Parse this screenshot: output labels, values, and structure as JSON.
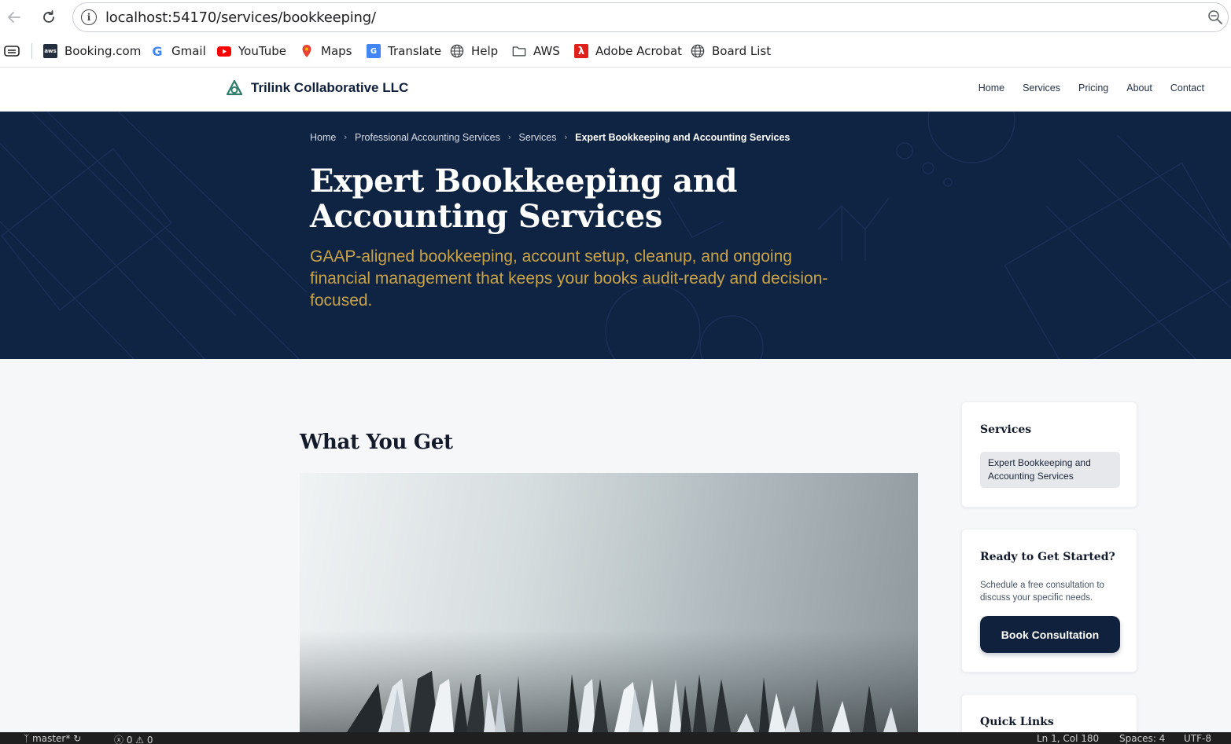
{
  "browser": {
    "url": "localhost:54170/services/bookkeeping/",
    "bookmarks": [
      {
        "label": "Booking.com",
        "icon": "aws-icon"
      },
      {
        "label": "Gmail",
        "icon": "google-icon"
      },
      {
        "label": "YouTube",
        "icon": "youtube-icon"
      },
      {
        "label": "Maps",
        "icon": "maps-pin-icon"
      },
      {
        "label": "Translate",
        "icon": "translate-icon"
      },
      {
        "label": "Help",
        "icon": "globe-icon"
      },
      {
        "label": "AWS",
        "icon": "folder-icon"
      },
      {
        "label": "Adobe Acrobat",
        "icon": "acrobat-icon"
      },
      {
        "label": "Board List",
        "icon": "globe-icon"
      }
    ]
  },
  "site": {
    "brand": "Trilink Collaborative LLC",
    "nav": [
      "Home",
      "Services",
      "Pricing",
      "About",
      "Contact"
    ]
  },
  "hero": {
    "breadcrumb": [
      "Home",
      "Professional Accounting Services",
      "Services",
      "Expert Bookkeeping and Accounting Services"
    ],
    "title": "Expert Bookkeeping and Accounting Services",
    "subtitle": "GAAP-aligned bookkeeping, account setup, cleanup, and ongoing financial management that keeps your books audit-ready and decision-focused."
  },
  "main": {
    "section_title": "What You Get"
  },
  "sidebar": {
    "services_title": "Services",
    "services_items": [
      "Expert Bookkeeping and Accounting Services"
    ],
    "cta_title": "Ready to Get Started?",
    "cta_text": "Schedule a free consultation to discuss your specific needs.",
    "cta_button": "Book Consultation",
    "quick_links_title": "Quick Links"
  },
  "statusbar": {
    "branch": "master*",
    "problems": "ⓧ 0 ⚠ 0",
    "position": "Ln 1, Col 180",
    "spaces": "Spaces: 4",
    "encoding": "UTF-8"
  },
  "colors": {
    "navy": "#10213d",
    "hero_bg": "#0f2343",
    "gold": "#c9a447",
    "logo_teal": "#2f7d6d"
  }
}
